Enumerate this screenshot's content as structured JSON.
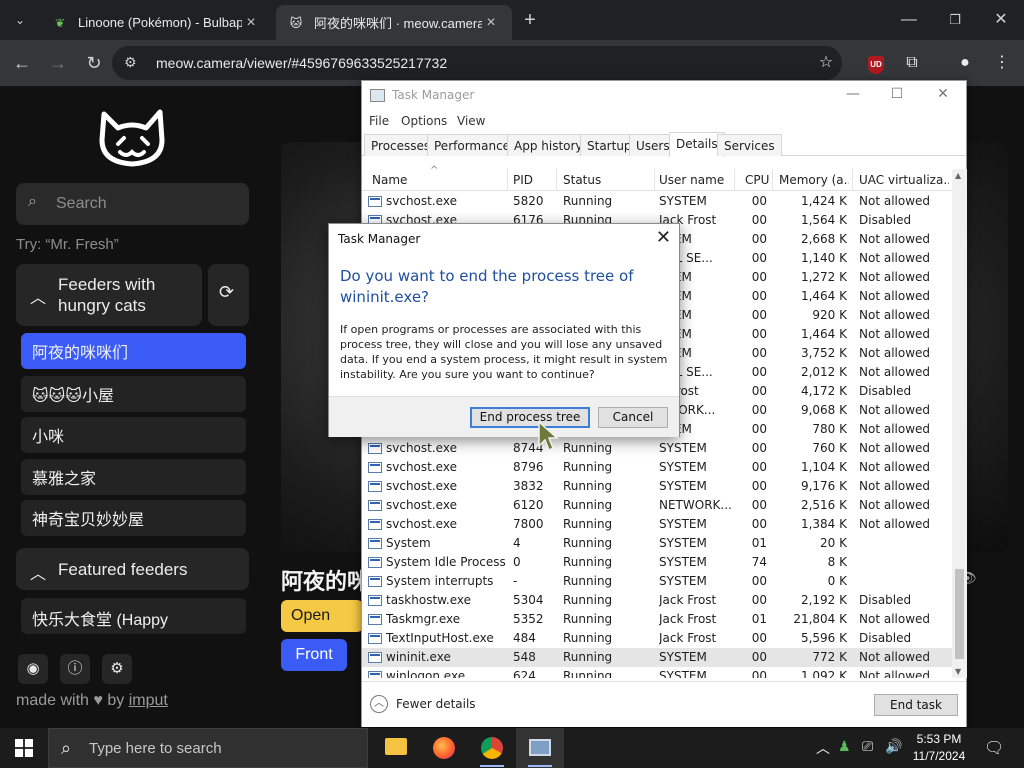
{
  "browser": {
    "tabs": [
      {
        "title": "Linoone (Pokémon) - Bulbaped",
        "icon": "leaf-icon"
      },
      {
        "title": "阿夜的咪咪们 · meow.camera",
        "icon": "cat-icon"
      }
    ],
    "url": "meow.camera/viewer/#4596769633525217732"
  },
  "site": {
    "search_placeholder": "Search",
    "try_hint": "Try: “Mr. Fresh”",
    "section1_title": "Feeders with hungry cats",
    "feeders": [
      "阿夜的咪咪们",
      "🐱🐱🐱小屋",
      "小咪",
      "慕雅之家",
      "神奇宝贝妙妙屋"
    ],
    "section2_title": "Featured feeders",
    "featured": [
      "快乐大食堂 (Happy"
    ],
    "cam_title": "阿夜的咪",
    "open_label": "Open",
    "front_label": "Front",
    "made_with_prefix": "made with",
    "made_with_by": "by",
    "made_with_author": "imput"
  },
  "taskmanager": {
    "title": "Task Manager",
    "menu": [
      "File",
      "Options",
      "View"
    ],
    "tabs": [
      "Processes",
      "Performance",
      "App history",
      "Startup",
      "Users",
      "Details",
      "Services"
    ],
    "active_tab": "Details",
    "columns": [
      "Name",
      "PID",
      "Status",
      "User name",
      "CPU",
      "Memory (a...",
      "UAC virtualiza..."
    ],
    "rows": [
      [
        "svchost.exe",
        "5820",
        "Running",
        "SYSTEM",
        "00",
        "1,424 K",
        "Not allowed"
      ],
      [
        "svchost.exe",
        "6176",
        "Running",
        "Jack Frost",
        "00",
        "1,564 K",
        "Disabled"
      ],
      [
        "",
        "",
        "",
        "STEM",
        "00",
        "2,668 K",
        "Not allowed"
      ],
      [
        "",
        "",
        "",
        "CAL SE...",
        "00",
        "1,140 K",
        "Not allowed"
      ],
      [
        "",
        "",
        "",
        "STEM",
        "00",
        "1,272 K",
        "Not allowed"
      ],
      [
        "",
        "",
        "",
        "STEM",
        "00",
        "1,464 K",
        "Not allowed"
      ],
      [
        "",
        "",
        "",
        "STEM",
        "00",
        "920 K",
        "Not allowed"
      ],
      [
        "",
        "",
        "",
        "STEM",
        "00",
        "1,464 K",
        "Not allowed"
      ],
      [
        "",
        "",
        "",
        "STEM",
        "00",
        "3,752 K",
        "Not allowed"
      ],
      [
        "",
        "",
        "",
        "CAL SE...",
        "00",
        "2,012 K",
        "Not allowed"
      ],
      [
        "",
        "",
        "",
        "k Frost",
        "00",
        "4,172 K",
        "Disabled"
      ],
      [
        "",
        "",
        "",
        "TWORK...",
        "00",
        "9,068 K",
        "Not allowed"
      ],
      [
        "",
        "",
        "",
        "STEM",
        "00",
        "780 K",
        "Not allowed"
      ],
      [
        "svchost.exe",
        "8744",
        "Running",
        "SYSTEM",
        "00",
        "760 K",
        "Not allowed"
      ],
      [
        "svchost.exe",
        "8796",
        "Running",
        "SYSTEM",
        "00",
        "1,104 K",
        "Not allowed"
      ],
      [
        "svchost.exe",
        "3832",
        "Running",
        "SYSTEM",
        "00",
        "9,176 K",
        "Not allowed"
      ],
      [
        "svchost.exe",
        "6120",
        "Running",
        "NETWORK...",
        "00",
        "2,516 K",
        "Not allowed"
      ],
      [
        "svchost.exe",
        "7800",
        "Running",
        "SYSTEM",
        "00",
        "1,384 K",
        "Not allowed"
      ],
      [
        "System",
        "4",
        "Running",
        "SYSTEM",
        "01",
        "20 K",
        ""
      ],
      [
        "System Idle Process",
        "0",
        "Running",
        "SYSTEM",
        "74",
        "8 K",
        ""
      ],
      [
        "System interrupts",
        "-",
        "Running",
        "SYSTEM",
        "00",
        "0 K",
        ""
      ],
      [
        "taskhostw.exe",
        "5304",
        "Running",
        "Jack Frost",
        "00",
        "2,192 K",
        "Disabled"
      ],
      [
        "Taskmgr.exe",
        "5352",
        "Running",
        "Jack Frost",
        "01",
        "21,804 K",
        "Not allowed"
      ],
      [
        "TextInputHost.exe",
        "484",
        "Running",
        "Jack Frost",
        "00",
        "5,596 K",
        "Disabled"
      ],
      [
        "wininit.exe",
        "548",
        "Running",
        "SYSTEM",
        "00",
        "772 K",
        "Not allowed"
      ],
      [
        "winlogon.exe",
        "624",
        "Running",
        "SYSTEM",
        "00",
        "1,092 K",
        "Not allowed"
      ]
    ],
    "selected_index": 24,
    "fewer_details": "Fewer details",
    "end_task": "End task"
  },
  "dialog": {
    "title": "Task Manager",
    "heading": "Do you want to end the process tree of wininit.exe?",
    "body": "If open programs or processes are associated with this process tree, they will close and you will lose any unsaved data. If you end a system process, it might result in system instability. Are you sure you want to continue?",
    "confirm": "End process tree",
    "cancel": "Cancel"
  },
  "taskbar": {
    "search_placeholder": "Type here to search",
    "time": "5:53 PM",
    "date": "11/7/2024"
  }
}
